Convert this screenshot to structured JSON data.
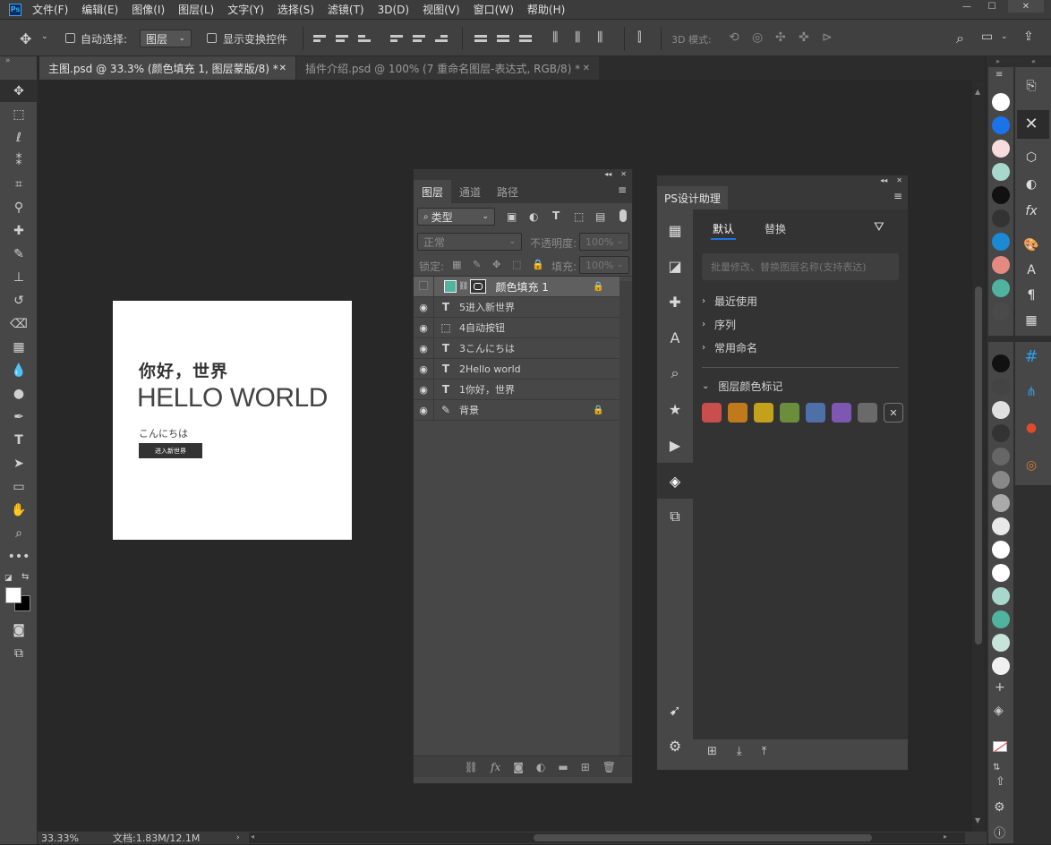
{
  "menu": [
    "文件(F)",
    "编辑(E)",
    "图像(I)",
    "图层(L)",
    "文字(Y)",
    "选择(S)",
    "滤镜(T)",
    "3D(D)",
    "视图(V)",
    "窗口(W)",
    "帮助(H)"
  ],
  "options": {
    "auto_select": "自动选择:",
    "auto_select_target": "图层",
    "show_transform": "显示变换控件",
    "mode_3d": "3D 模式:"
  },
  "tabs": [
    {
      "label": "主图.psd @ 33.3% (颜色填充 1, 图层蒙版/8) *",
      "active": true
    },
    {
      "label": "插件介绍.psd @ 100% (7 重命名图层-表达式, RGB/8) *",
      "active": false
    }
  ],
  "canvas": {
    "title": "你好，世界",
    "subtitle": "HELLO WORLD",
    "japanese": "こんにちは",
    "button": "进入新世界"
  },
  "layers_panel": {
    "tabs": [
      "图层",
      "通道",
      "路径"
    ],
    "filter": "类型",
    "blend": "正常",
    "opacity_label": "不透明度:",
    "opacity": "100%",
    "lock_label": "锁定:",
    "fill_label": "填充:",
    "fill": "100%",
    "layers": [
      {
        "name": "颜色填充 1",
        "type": "fill",
        "visible": false,
        "locked": true,
        "selected": true
      },
      {
        "name": "5进入新世界",
        "type": "T",
        "visible": true,
        "locked": false,
        "selected": false
      },
      {
        "name": "4自动按钮",
        "type": "shape",
        "visible": true,
        "locked": false,
        "selected": false
      },
      {
        "name": "3こんにちは",
        "type": "T",
        "visible": true,
        "locked": false,
        "selected": false
      },
      {
        "name": "2Hello world",
        "type": "T",
        "visible": true,
        "locked": false,
        "selected": false
      },
      {
        "name": "1你好，世界",
        "type": "T",
        "visible": true,
        "locked": false,
        "selected": false
      },
      {
        "name": "背景",
        "type": "brush",
        "visible": true,
        "locked": true,
        "selected": false
      }
    ]
  },
  "assistant": {
    "title": "PS设计助理",
    "tab_default": "默认",
    "tab_replace": "替换",
    "search_placeholder": "批量修改、替换图层名称(支持表达)",
    "sections": [
      "最近使用",
      "序列",
      "常用命名"
    ],
    "color_section": "图层颜色标记",
    "colors": [
      "#c94f4f",
      "#c07a1c",
      "#c4a11d",
      "#6b8e3c",
      "#4f6fa8",
      "#7e57b3",
      "#6a6a6a"
    ]
  },
  "swatches_top": [
    "#ffffff",
    "#1a73e8",
    "#f6dcda",
    "#a8d8cc",
    "#111111",
    "#333333",
    "#1a8ad4",
    "#e58a80",
    "#4fb3a0",
    "#4a4a4a"
  ],
  "swatches_bottom": [
    "#111111",
    "#444444",
    "#e0e0e0",
    "#333333",
    "#666666",
    "#888888",
    "#aaaaaa",
    "#e8e8e8",
    "#ffffff",
    "#ffffff",
    "#a8d8cc",
    "#4fb3a0",
    "#c6e4da",
    "#f0f0f0"
  ],
  "status": {
    "zoom": "33.33%",
    "doc": "文档:1.83M/12.1M"
  }
}
